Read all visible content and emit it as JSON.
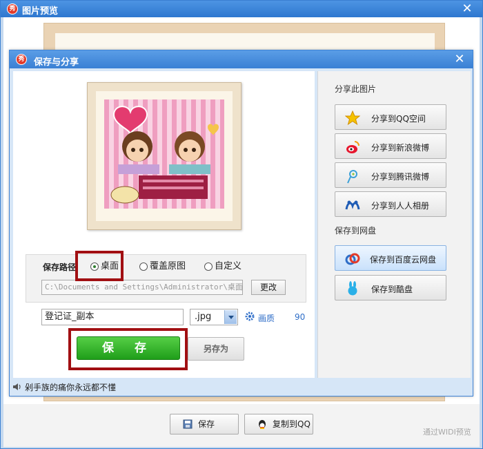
{
  "outer_window": {
    "title": "图片预览",
    "close_symbol": "✕",
    "logo_glyph": "秀"
  },
  "bottom_bar": {
    "save_label": "保存",
    "copy_qq_label": "复制到QQ",
    "watermark": "通过WIDI预览"
  },
  "dialog": {
    "title": "保存与分享",
    "close_symbol": "✕",
    "logo_glyph": "秀",
    "status_text": "剁手族的痛你永远都不懂",
    "save_path": {
      "label": "保存路径",
      "options": [
        {
          "label": "桌面",
          "selected": true
        },
        {
          "label": "覆盖原图",
          "selected": false
        },
        {
          "label": "自定义",
          "selected": false
        }
      ],
      "path_value": "C:\\Documents and Settings\\Administrator\\桌面",
      "change_button": "更改"
    },
    "file": {
      "name": "登记证_副本",
      "extension": ".jpg",
      "quality_label": "画质",
      "quality_value": "90"
    },
    "save_button": "保 存",
    "save_as_button": "另存为",
    "share": {
      "section_title": "分享此图片",
      "items": [
        {
          "label": "分享到QQ空间",
          "icon": "qzone-star-icon"
        },
        {
          "label": "分享到新浪微博",
          "icon": "sina-weibo-icon"
        },
        {
          "label": "分享到腾讯微博",
          "icon": "tencent-weibo-icon"
        },
        {
          "label": "分享到人人相册",
          "icon": "renren-icon"
        }
      ]
    },
    "cloud": {
      "section_title": "保存到网盘",
      "items": [
        {
          "label": "保存到百度云网盘",
          "icon": "baidu-cloud-icon",
          "active": true
        },
        {
          "label": "保存到酷盘",
          "icon": "kupan-rabbit-icon",
          "active": false
        }
      ]
    }
  },
  "colors": {
    "titlebar_blue": "#3a80d4",
    "save_green": "#2fb52a",
    "highlight_red": "#a10f12"
  }
}
